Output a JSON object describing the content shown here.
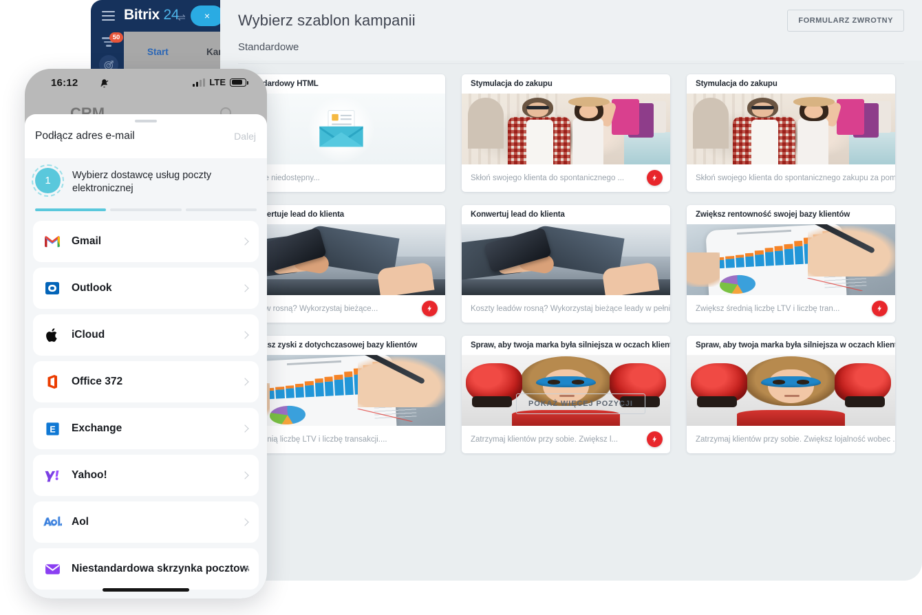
{
  "desktop": {
    "page_title": "Wybierz szablon kampanii",
    "feedback_button": "FORMULARZ ZWROTNY",
    "section_label": "Standardowe",
    "show_more_button": "POKAŻ WIĘCEJ POZYCJI",
    "templates": [
      {
        "title": "Standardowy HTML",
        "description": "będzie niedostępny...",
        "art": "envelope",
        "badge": false
      },
      {
        "title": "Stymulacja do zakupu",
        "description": "Skłoń swojego klienta do spontanicznego ...",
        "art": "shoppers",
        "badge": true
      },
      {
        "title": "Stymulacja do zakupu",
        "description": "Skłoń swojego klienta do spontanicznego zakupu za pomoc...",
        "art": "shoppers",
        "badge": false
      },
      {
        "title": "Konwertuje lead do klienta",
        "description": "leadów rosną? Wykorzystaj bieżące...",
        "art": "handshake",
        "badge": true
      },
      {
        "title": "Konwertuj lead do klienta",
        "description": "Koszty leadów rosną? Wykorzystaj bieżące leady w pełni ...",
        "art": "handshake",
        "badge": false
      },
      {
        "title": "Zwiększ rentowność swojej bazy klientów",
        "description": "Zwiększ średnią liczbę LTV i liczbę tran...",
        "art": "chart",
        "badge": true
      },
      {
        "title": "Zwiększ zyski z dotychczasowej bazy klientów",
        "description": "z średnią liczbę LTV i liczbę transakcji....",
        "art": "chart",
        "badge": false
      },
      {
        "title": "Spraw, aby twoja marka była silniejsza w oczach klientów",
        "description": "Zatrzymaj klientów przy sobie. Zwiększ l...",
        "art": "boxing",
        "badge": true
      },
      {
        "title": "Spraw, aby twoja marka była silniejsza w oczach klientów",
        "description": "Zatrzymaj klientów przy sobie. Zwiększ lojalność wobec ...",
        "art": "boxing",
        "badge": false
      }
    ]
  },
  "bitrix_window": {
    "logo_name": "Bitrix",
    "logo_number": "24",
    "swap_icon": "⇌",
    "close_label": "×",
    "filter_badge": "50",
    "tabs": [
      {
        "label": "Start",
        "active": true
      },
      {
        "label": "Kampani",
        "active": false
      }
    ]
  },
  "phone": {
    "status": {
      "time": "16:12",
      "network": "LTE"
    },
    "background_title": "CRM",
    "sheet": {
      "title": "Podłącz adres e-mail",
      "next_label": "Dalej",
      "step_number": "1",
      "step_title": "Wybierz dostawcę usług poczty elektronicznej",
      "progress_total": 3,
      "progress_done": 1,
      "providers": [
        {
          "label": "Gmail",
          "icon": "gmail-icon"
        },
        {
          "label": "Outlook",
          "icon": "outlook-icon"
        },
        {
          "label": "iCloud",
          "icon": "apple-icon"
        },
        {
          "label": "Office 372",
          "icon": "office-icon"
        },
        {
          "label": "Exchange",
          "icon": "exchange-icon"
        },
        {
          "label": "Yahoo!",
          "icon": "yahoo-icon"
        },
        {
          "label": "Aol",
          "icon": "aol-icon"
        },
        {
          "label": "Niestandardowa skrzynka pocztowa",
          "icon": "mail-icon"
        }
      ]
    }
  },
  "colors": {
    "accent_teal": "#5ac8dc",
    "bitrix_navy": "#16325c",
    "bitrix_cyan": "#2aabe3",
    "badge_red": "#e8563a",
    "bolt_red": "#e8262b",
    "panel_bg": "#eaeef0"
  }
}
